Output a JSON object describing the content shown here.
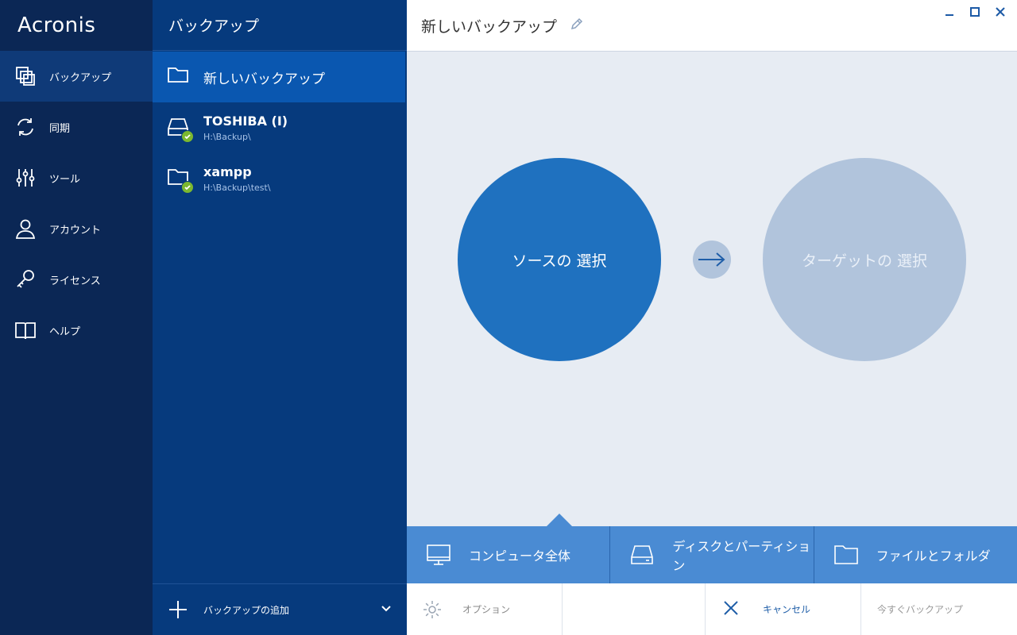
{
  "app": {
    "logo": "Acronis"
  },
  "nav": {
    "items": [
      {
        "label": "バックアップ",
        "icon": "backup-icon"
      },
      {
        "label": "同期",
        "icon": "sync-icon"
      },
      {
        "label": "ツール",
        "icon": "tools-icon"
      },
      {
        "label": "アカウント",
        "icon": "account-icon"
      },
      {
        "label": "ライセンス",
        "icon": "key-icon"
      },
      {
        "label": "ヘルプ",
        "icon": "book-icon"
      }
    ]
  },
  "backups": {
    "header": "バックアップ",
    "items": [
      {
        "name": "新しいバックアップ",
        "icon": "folder-icon"
      },
      {
        "name": "TOSHIBA (I)",
        "path": "H:\\Backup\\",
        "icon": "drive-icon",
        "status": "ok"
      },
      {
        "name": "xampp",
        "path": "H:\\Backup\\test\\",
        "icon": "folder-icon",
        "status": "ok"
      }
    ],
    "add_label": "バックアップの追加"
  },
  "main": {
    "title": "新しいバックアップ",
    "source_label": "ソースの 選択",
    "target_label": "ターゲットの 選択",
    "source_tabs": [
      {
        "label": "コンピュータ全体",
        "icon": "monitor-icon"
      },
      {
        "label": "ディスクとパーティション",
        "icon": "disk-icon"
      },
      {
        "label": "ファイルとフォルダ",
        "icon": "folder-icon"
      }
    ],
    "actions": {
      "options": "オプション",
      "cancel": "キャンセル",
      "backup_now": "今すぐバックアップ"
    }
  },
  "colors": {
    "nav_bg": "#0b2755",
    "panel_bg": "#063a7d",
    "active_item": "#0a57b0",
    "source_circle": "#1f71bf",
    "target_circle": "#b1c4dc",
    "tab_bar": "#4a8bd3",
    "check": "#7cb82f"
  }
}
